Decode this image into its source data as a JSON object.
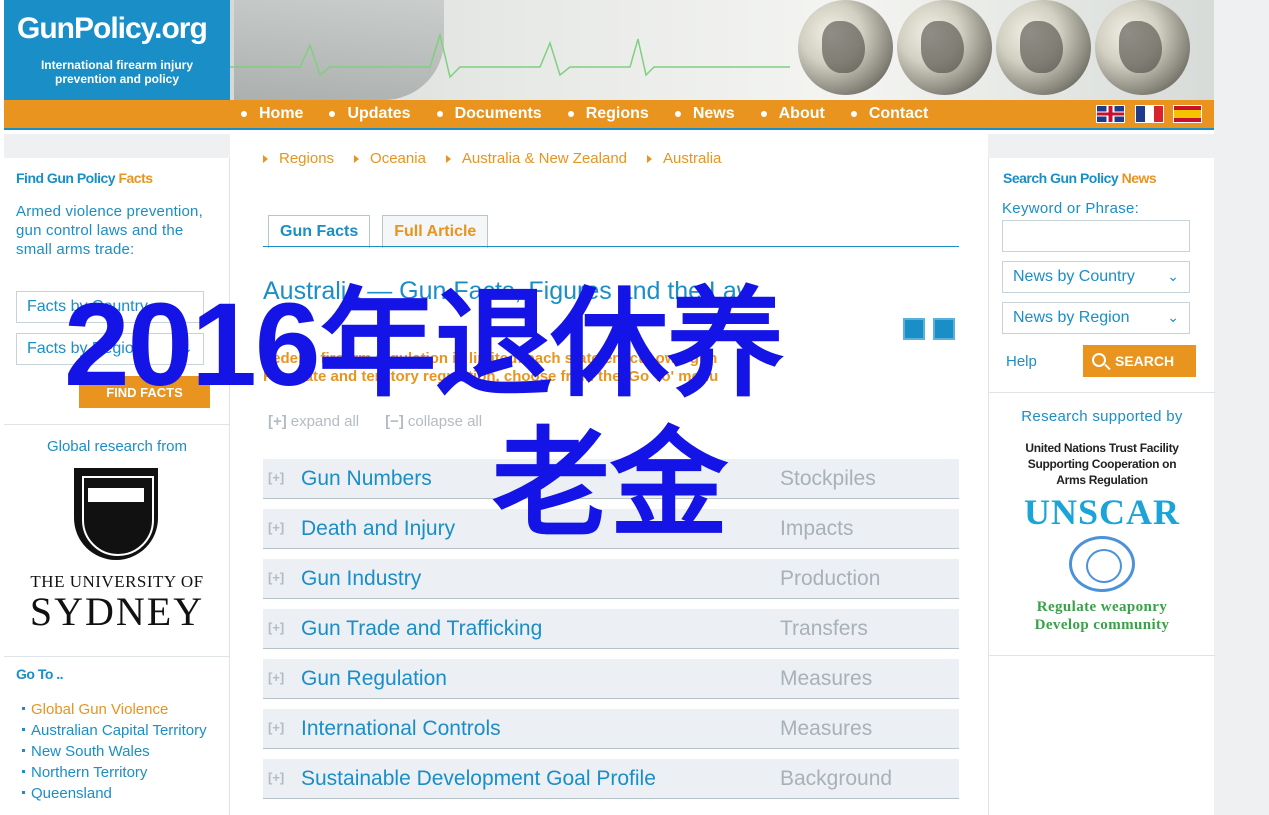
{
  "header": {
    "logo_name": "GunPolicy.org",
    "logo_sub_line1": "International firearm injury",
    "logo_sub_line2": "prevention and policy"
  },
  "nav": {
    "items": [
      "Home",
      "Updates",
      "Documents",
      "Regions",
      "News",
      "About",
      "Contact"
    ],
    "flags": [
      "english-flag-icon",
      "french-flag-icon",
      "spanish-flag-icon"
    ]
  },
  "left": {
    "find_heading_a": "Find Gun Policy",
    "find_heading_b": "Facts",
    "find_desc": "Armed violence prevention, gun control laws and the small arms trade:",
    "facts_by_country": "Facts by Country",
    "facts_by_region": "Facts by Region",
    "find_facts_btn": "FIND FACTS",
    "global_research": "Global research from",
    "uni_line1": "THE UNIVERSITY OF",
    "uni_line2": "SYDNEY",
    "goto_heading": "Go To ..",
    "goto_items": [
      "Global Gun Violence",
      "Australian Capital Territory",
      "New South Wales",
      "Northern Territory",
      "Queensland"
    ]
  },
  "right": {
    "news_heading_a": "Search Gun Policy",
    "news_heading_b": "News",
    "keyword_label": "Keyword or Phrase:",
    "keyword_value": "",
    "news_by_country": "News by Country",
    "news_by_region": "News by Region",
    "help": "Help",
    "search_btn": "SEARCH",
    "research_supported": "Research supported by",
    "facility_line1": "United Nations Trust Facility",
    "facility_line2": "Supporting Cooperation on",
    "facility_line3": "Arms Regulation",
    "unscar": "UNSCAR",
    "tag_line1": "Regulate weaponry",
    "tag_line2": "Develop community"
  },
  "main": {
    "breadcrumb": [
      "Regions",
      "Oceania",
      "Australia & New Zealand",
      "Australia"
    ],
    "tabs": [
      "Gun Facts",
      "Full Article"
    ],
    "page_title": "Australia — Gun Facts, Figures and the Law",
    "intro_line1": "Federal firearm regulation is limited: each state enacts own gun",
    "intro_line2": "For state and territory regulation, choose from the 'Go To' menu",
    "expand_all": "expand all",
    "collapse_all": "collapse all",
    "sections": [
      {
        "title": "Gun Numbers",
        "category": "Stockpiles"
      },
      {
        "title": "Death and Injury",
        "category": "Impacts"
      },
      {
        "title": "Gun Industry",
        "category": "Production"
      },
      {
        "title": "Gun Trade and Trafficking",
        "category": "Transfers"
      },
      {
        "title": "Gun Regulation",
        "category": "Measures"
      },
      {
        "title": "International Controls",
        "category": "Measures"
      },
      {
        "title": "Sustainable Development Goal Profile",
        "category": "Background"
      }
    ]
  },
  "overlay": {
    "line1": "2016年退休养",
    "line2": "老金"
  },
  "colors": {
    "brand_blue": "#1a8ec7",
    "brand_orange": "#e8941f",
    "overlay_blue": "#1414e6"
  }
}
